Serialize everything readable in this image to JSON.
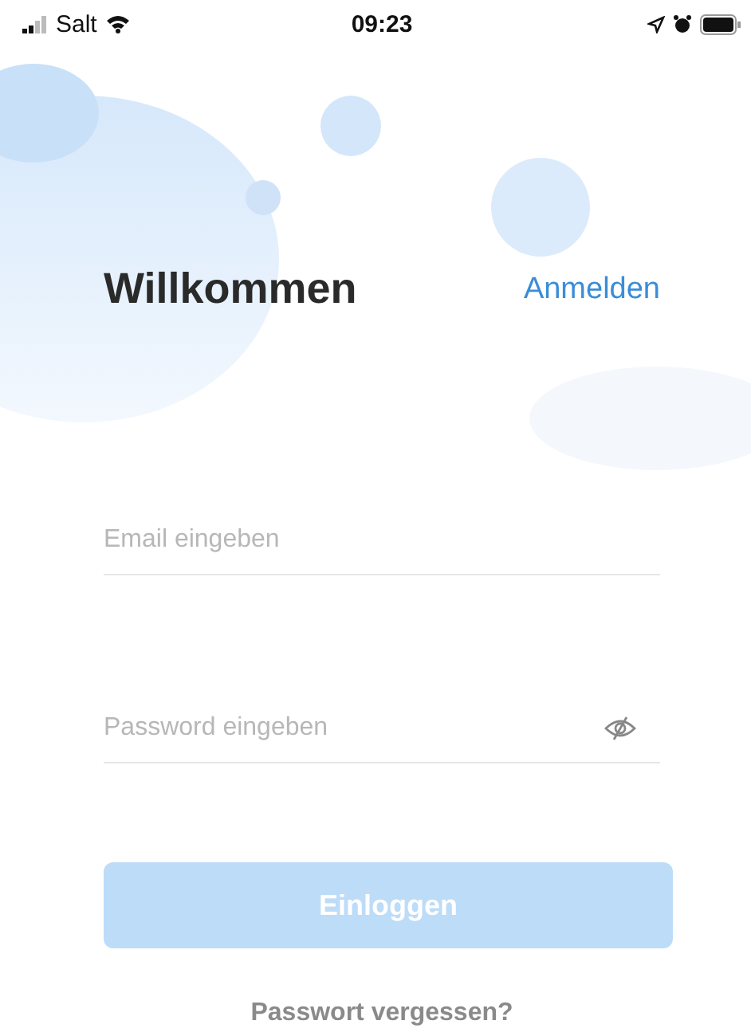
{
  "status_bar": {
    "carrier": "Salt",
    "time": "09:23"
  },
  "header": {
    "title": "Willkommen",
    "link": "Anmelden"
  },
  "fields": [
    {
      "kind": "email",
      "placeholder": "Email eingeben"
    },
    {
      "kind": "password",
      "placeholder": "Password eingeben"
    }
  ],
  "login_button": {
    "label": "Einloggen",
    "disabled": true
  },
  "forgot_link": "Passwort vergessen?"
}
